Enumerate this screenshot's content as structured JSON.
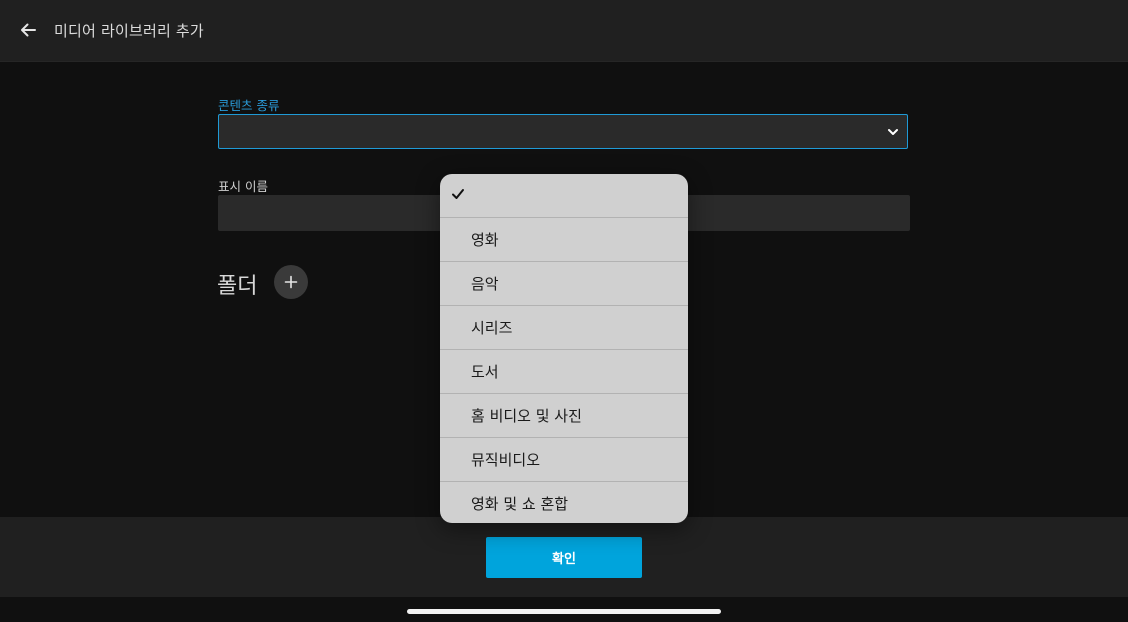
{
  "header": {
    "title": "미디어 라이브러리 추가"
  },
  "form": {
    "content_type_label": "콘텐츠 종류",
    "content_type_value": "",
    "display_name_label": "표시 이름",
    "display_name_value": "",
    "folders_heading": "폴더"
  },
  "dropdown": {
    "selected": "",
    "options": [
      {
        "label": ""
      },
      {
        "label": "영화"
      },
      {
        "label": "음악"
      },
      {
        "label": "시리즈"
      },
      {
        "label": "도서"
      },
      {
        "label": "홈 비디오 및 사진"
      },
      {
        "label": "뮤직비디오"
      },
      {
        "label": "영화 및 쇼 혼합"
      }
    ]
  },
  "footer": {
    "confirm_label": "확인"
  },
  "colors": {
    "accent": "#00a4dc",
    "label_accent": "#2a9ad8",
    "background": "#101010",
    "panel": "#202020",
    "dropdown_bg": "#d0d0d0"
  },
  "icons": {
    "back": "arrow-left-icon",
    "chevron": "chevron-down-icon",
    "add": "plus-icon",
    "check": "checkmark-icon"
  }
}
